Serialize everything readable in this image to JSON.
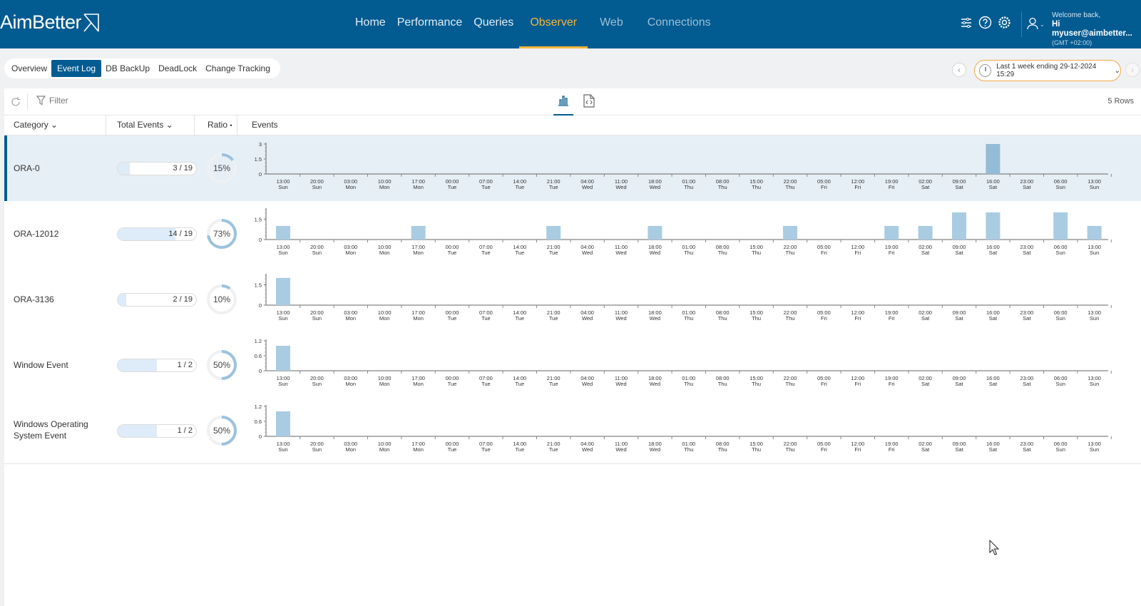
{
  "app": {
    "logo_text": "AimBetter",
    "nav": [
      {
        "label": "Home",
        "state": "normal"
      },
      {
        "label": "Performance",
        "state": "normal"
      },
      {
        "label": "Queries",
        "state": "normal"
      },
      {
        "label": "Observer",
        "state": "active"
      },
      {
        "label": "Web",
        "state": "dim"
      },
      {
        "label": "Connections",
        "state": "dim"
      }
    ],
    "header_icons": [
      "sliders-icon",
      "help-icon",
      "gear-icon"
    ],
    "user": {
      "welcome": "Welcome back,",
      "name": "Hi myuser@aimbetter...",
      "timezone": "(GMT +02:00)"
    }
  },
  "subtabs": [
    {
      "label": "Overview",
      "active": false
    },
    {
      "label": "Event Log",
      "active": true
    },
    {
      "label": "DB BackUp",
      "active": false
    },
    {
      "label": "DeadLock",
      "active": false
    },
    {
      "label": "Change Tracking",
      "active": false
    }
  ],
  "time_range": {
    "label": "Last 1 week ending  29-12-2024 15:29"
  },
  "toolbar": {
    "filter_placeholder": "Filter",
    "rows_count": "5 Rows"
  },
  "table": {
    "headers": {
      "category": "Category",
      "total": "Total Events",
      "ratio": "Ratio",
      "events": "Events"
    },
    "x_ticks": [
      {
        "time": "13:00",
        "day": "Sun"
      },
      {
        "time": "20:00",
        "day": "Sun"
      },
      {
        "time": "03:00",
        "day": "Mon"
      },
      {
        "time": "10:00",
        "day": "Mon"
      },
      {
        "time": "17:00",
        "day": "Mon"
      },
      {
        "time": "00:00",
        "day": "Tue"
      },
      {
        "time": "07:00",
        "day": "Tue"
      },
      {
        "time": "14:00",
        "day": "Tue"
      },
      {
        "time": "21:00",
        "day": "Tue"
      },
      {
        "time": "04:00",
        "day": "Wed"
      },
      {
        "time": "11:00",
        "day": "Wed"
      },
      {
        "time": "18:00",
        "day": "Wed"
      },
      {
        "time": "01:00",
        "day": "Thu"
      },
      {
        "time": "08:00",
        "day": "Thu"
      },
      {
        "time": "15:00",
        "day": "Thu"
      },
      {
        "time": "22:00",
        "day": "Thu"
      },
      {
        "time": "05:00",
        "day": "Fri"
      },
      {
        "time": "12:00",
        "day": "Fri"
      },
      {
        "time": "19:00",
        "day": "Fri"
      },
      {
        "time": "02:00",
        "day": "Sat"
      },
      {
        "time": "09:00",
        "day": "Sat"
      },
      {
        "time": "16:00",
        "day": "Sat"
      },
      {
        "time": "23:00",
        "day": "Sat"
      },
      {
        "time": "06:00",
        "day": "Sun"
      },
      {
        "time": "13:00",
        "day": "Sun"
      }
    ],
    "rows": [
      {
        "category": "ORA-0",
        "total_text": "3 / 19",
        "fraction": 0.158,
        "ratio_text": "15%",
        "ratio": 0.15,
        "selected": true,
        "y_ticks": [
          "3",
          "1.5",
          "0"
        ],
        "ymax": 3,
        "values": [
          0,
          0,
          0,
          0,
          0,
          0,
          0,
          0,
          0,
          0,
          0,
          0,
          0,
          0,
          0,
          0,
          0,
          0,
          0,
          0,
          0,
          3,
          0,
          0,
          0
        ]
      },
      {
        "category": "ORA-12012",
        "total_text": "14 / 19",
        "fraction": 0.737,
        "ratio_text": "73%",
        "ratio": 0.73,
        "selected": false,
        "y_ticks": [
          "1.5",
          "0"
        ],
        "ymax": 2.2,
        "values": [
          1,
          0,
          0,
          0,
          1,
          0,
          0,
          0,
          1,
          0,
          0,
          1,
          0,
          0,
          0,
          1,
          0,
          0,
          1,
          1,
          2,
          2,
          0,
          2,
          1
        ]
      },
      {
        "category": "ORA-3136",
        "total_text": "2 / 19",
        "fraction": 0.105,
        "ratio_text": "10%",
        "ratio": 0.1,
        "selected": false,
        "y_ticks": [
          "1.5",
          "0"
        ],
        "ymax": 2.2,
        "values": [
          2,
          0,
          0,
          0,
          0,
          0,
          0,
          0,
          0,
          0,
          0,
          0,
          0,
          0,
          0,
          0,
          0,
          0,
          0,
          0,
          0,
          0,
          0,
          0,
          0
        ]
      },
      {
        "category": "Window Event",
        "total_text": "1 / 2",
        "fraction": 0.5,
        "ratio_text": "50%",
        "ratio": 0.5,
        "selected": false,
        "y_ticks": [
          "1.2",
          "0.6",
          "0"
        ],
        "ymax": 1.2,
        "values": [
          1,
          0,
          0,
          0,
          0,
          0,
          0,
          0,
          0,
          0,
          0,
          0,
          0,
          0,
          0,
          0,
          0,
          0,
          0,
          0,
          0,
          0,
          0,
          0,
          0
        ]
      },
      {
        "category": "Windows Operating System Event",
        "total_text": "1 / 2",
        "fraction": 0.5,
        "ratio_text": "50%",
        "ratio": 0.5,
        "selected": false,
        "y_ticks": [
          "1.2",
          "0.6",
          "0"
        ],
        "ymax": 1.2,
        "values": [
          1,
          0,
          0,
          0,
          0,
          0,
          0,
          0,
          0,
          0,
          0,
          0,
          0,
          0,
          0,
          0,
          0,
          0,
          0,
          0,
          0,
          0,
          0,
          0,
          0
        ]
      }
    ]
  },
  "colors": {
    "brand": "#025b91",
    "active_tab": "#f6b73c",
    "bar": "#a9cce3",
    "bar_selected": "#93bcd8",
    "ratio_ring": "#9cc2dd"
  }
}
